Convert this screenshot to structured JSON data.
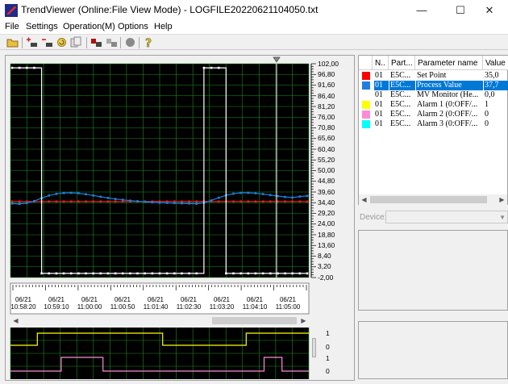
{
  "window": {
    "title": "TrendViewer (Online:File View Mode) - LOGFILE20220621104050.txt",
    "minimize_icon": "minimize-icon",
    "maximize_icon": "maximize-icon",
    "close_icon": "close-icon"
  },
  "menu": {
    "file": "File",
    "settings": "Settings",
    "operation": "Operation(M)",
    "options": "Options",
    "help": "Help"
  },
  "toolbar": [
    "open-folder-icon",
    "add-trend-icon",
    "remove-trend-icon",
    "refresh-icon",
    "copy-icon",
    "record-start-icon",
    "record-stop-icon",
    "stop-circle-icon",
    "help-icon"
  ],
  "chart": {
    "y_ticks": [
      "102,00",
      "96,80",
      "91,60",
      "86,40",
      "81,20",
      "76,00",
      "70,80",
      "65,60",
      "60,40",
      "55,20",
      "50,00",
      "44,80",
      "39,60",
      "34,40",
      "29,20",
      "24,00",
      "18,80",
      "13,60",
      "8,40",
      "3,20",
      "-2,00"
    ],
    "time_ticks": [
      {
        "date": "06/21",
        "time": "10:58:20"
      },
      {
        "date": "06/21",
        "time": "10:59:10"
      },
      {
        "date": "06/21",
        "time": "11:00:00"
      },
      {
        "date": "06/21",
        "time": "11:00:50"
      },
      {
        "date": "06/21",
        "time": "11:01:40"
      },
      {
        "date": "06/21",
        "time": "11:02:30"
      },
      {
        "date": "06/21",
        "time": "11:03:20"
      },
      {
        "date": "06/21",
        "time": "11:04:10"
      },
      {
        "date": "06/21",
        "time": "11:05:00"
      }
    ],
    "digital_labels": [
      "1",
      "0",
      "1",
      "0"
    ],
    "colors": {
      "background": "#000000",
      "grid": "#1f8c1f",
      "mv": "#ffffff",
      "pv": "#1e7fe0",
      "sp": "#e02020",
      "alarm1": "#ffff00",
      "alarm2": "#ff8ad8"
    }
  },
  "chart_data": {
    "type": "line",
    "y_range": [
      -2.0,
      102.0
    ],
    "series": [
      {
        "name": "Set Point",
        "color": "#e02020",
        "values": [
          35.0,
          35.0,
          35.0,
          35.0,
          35.0,
          35.0,
          35.0,
          35.0,
          35.0,
          35.0,
          35.0,
          35.0,
          35.0,
          35.0,
          35.0,
          35.0,
          35.0,
          35.0,
          35.0,
          35.0,
          35.0,
          35.0,
          35.0,
          35.0,
          35.0,
          35.0,
          35.0,
          35.0,
          35.0,
          35.0,
          35.0,
          35.0,
          35.0,
          35.0,
          35.0,
          35.0,
          35.0,
          35.0,
          35.0,
          35.0,
          35.0
        ]
      },
      {
        "name": "Process Value",
        "color": "#1e7fe0",
        "values": [
          34.0,
          33.8,
          34.2,
          35.2,
          36.6,
          37.9,
          38.7,
          39.1,
          39.2,
          39.0,
          38.5,
          37.9,
          37.3,
          36.7,
          36.2,
          35.8,
          35.4,
          35.1,
          34.8,
          34.6,
          34.4,
          34.3,
          34.2,
          34.1,
          34.0,
          33.9,
          34.4,
          35.5,
          36.8,
          38.0,
          38.8,
          39.2,
          39.2,
          39.0,
          38.6,
          38.1,
          37.6,
          37.2,
          36.9,
          37.4,
          37.7
        ]
      },
      {
        "name": "MV Monitor (Heating)",
        "color": "#ffffff",
        "values": [
          100.0,
          100.0,
          100.0,
          100.0,
          0.0,
          0.0,
          0.0,
          0.0,
          0.0,
          0.0,
          0.0,
          0.0,
          0.0,
          0.0,
          0.0,
          0.0,
          0.0,
          0.0,
          0.0,
          0.0,
          0.0,
          0.0,
          0.0,
          0.0,
          0.0,
          0.0,
          100.0,
          100.0,
          100.0,
          0.0,
          0.0,
          0.0,
          0.0,
          0.0,
          0.0,
          0.0,
          0.0,
          0.0,
          0.0,
          0.0,
          0.0
        ]
      }
    ],
    "digital": [
      {
        "name": "Alarm 1",
        "color": "#ffff00",
        "transitions": [
          [
            0.0,
            0
          ],
          [
            0.09,
            1
          ],
          [
            0.51,
            0
          ],
          [
            0.79,
            1
          ],
          [
            1.0,
            1
          ]
        ]
      },
      {
        "name": "Alarm 2",
        "color": "#ff8ad8",
        "transitions": [
          [
            0.0,
            0
          ],
          [
            0.17,
            1
          ],
          [
            0.31,
            0
          ],
          [
            0.85,
            1
          ],
          [
            0.91,
            0
          ],
          [
            1.0,
            0
          ]
        ]
      }
    ]
  },
  "parameters": {
    "headers": [
      "",
      "N..",
      "Part...",
      "Parameter name",
      "Value"
    ],
    "rows": [
      {
        "color": "#ff0000",
        "n": "01",
        "part": "E5C...",
        "name": "Set Point",
        "value": "35,0",
        "selected": false
      },
      {
        "color": "#1e7fe0",
        "n": "01",
        "part": "E5C...",
        "name": "Process Value",
        "value": "37,7",
        "selected": true
      },
      {
        "color": "#ffffff",
        "n": "01",
        "part": "E5C...",
        "name": "MV Monitor (He...",
        "value": "0,0",
        "selected": false
      },
      {
        "color": "#ffff00",
        "n": "01",
        "part": "E5C...",
        "name": "Alarm 1 (0:OFF/...",
        "value": "1",
        "selected": false
      },
      {
        "color": "#ff8ad8",
        "n": "01",
        "part": "E5C...",
        "name": "Alarm 2 (0:OFF/...",
        "value": "0",
        "selected": false
      },
      {
        "color": "#00ffff",
        "n": "01",
        "part": "E5C...",
        "name": "Alarm 3 (0:OFF/...",
        "value": "0",
        "selected": false
      }
    ],
    "device_label": "Device:"
  }
}
